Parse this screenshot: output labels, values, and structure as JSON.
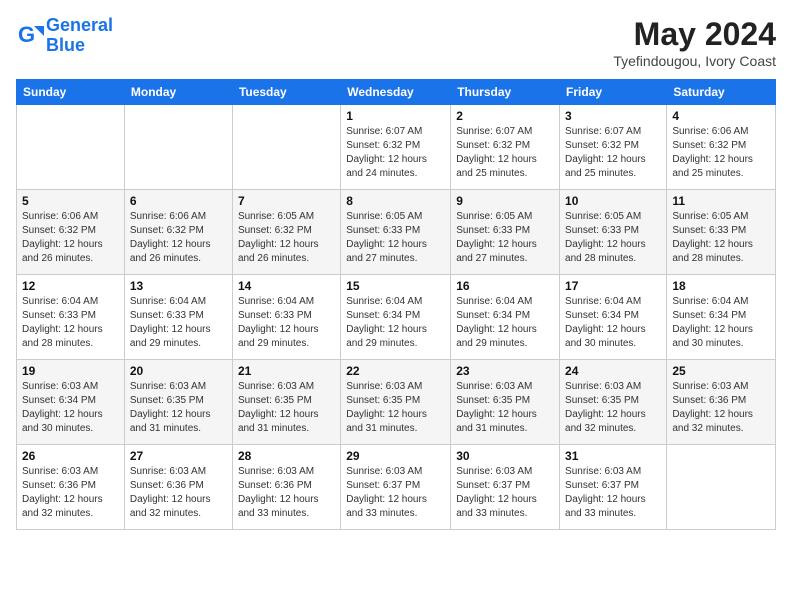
{
  "header": {
    "logo_line1": "General",
    "logo_line2": "Blue",
    "month_year": "May 2024",
    "location": "Tyefindougou, Ivory Coast"
  },
  "days_of_week": [
    "Sunday",
    "Monday",
    "Tuesday",
    "Wednesday",
    "Thursday",
    "Friday",
    "Saturday"
  ],
  "weeks": [
    [
      {
        "day": "",
        "info": ""
      },
      {
        "day": "",
        "info": ""
      },
      {
        "day": "",
        "info": ""
      },
      {
        "day": "1",
        "info": "Sunrise: 6:07 AM\nSunset: 6:32 PM\nDaylight: 12 hours\nand 24 minutes."
      },
      {
        "day": "2",
        "info": "Sunrise: 6:07 AM\nSunset: 6:32 PM\nDaylight: 12 hours\nand 25 minutes."
      },
      {
        "day": "3",
        "info": "Sunrise: 6:07 AM\nSunset: 6:32 PM\nDaylight: 12 hours\nand 25 minutes."
      },
      {
        "day": "4",
        "info": "Sunrise: 6:06 AM\nSunset: 6:32 PM\nDaylight: 12 hours\nand 25 minutes."
      }
    ],
    [
      {
        "day": "5",
        "info": "Sunrise: 6:06 AM\nSunset: 6:32 PM\nDaylight: 12 hours\nand 26 minutes."
      },
      {
        "day": "6",
        "info": "Sunrise: 6:06 AM\nSunset: 6:32 PM\nDaylight: 12 hours\nand 26 minutes."
      },
      {
        "day": "7",
        "info": "Sunrise: 6:05 AM\nSunset: 6:32 PM\nDaylight: 12 hours\nand 26 minutes."
      },
      {
        "day": "8",
        "info": "Sunrise: 6:05 AM\nSunset: 6:33 PM\nDaylight: 12 hours\nand 27 minutes."
      },
      {
        "day": "9",
        "info": "Sunrise: 6:05 AM\nSunset: 6:33 PM\nDaylight: 12 hours\nand 27 minutes."
      },
      {
        "day": "10",
        "info": "Sunrise: 6:05 AM\nSunset: 6:33 PM\nDaylight: 12 hours\nand 28 minutes."
      },
      {
        "day": "11",
        "info": "Sunrise: 6:05 AM\nSunset: 6:33 PM\nDaylight: 12 hours\nand 28 minutes."
      }
    ],
    [
      {
        "day": "12",
        "info": "Sunrise: 6:04 AM\nSunset: 6:33 PM\nDaylight: 12 hours\nand 28 minutes."
      },
      {
        "day": "13",
        "info": "Sunrise: 6:04 AM\nSunset: 6:33 PM\nDaylight: 12 hours\nand 29 minutes."
      },
      {
        "day": "14",
        "info": "Sunrise: 6:04 AM\nSunset: 6:33 PM\nDaylight: 12 hours\nand 29 minutes."
      },
      {
        "day": "15",
        "info": "Sunrise: 6:04 AM\nSunset: 6:34 PM\nDaylight: 12 hours\nand 29 minutes."
      },
      {
        "day": "16",
        "info": "Sunrise: 6:04 AM\nSunset: 6:34 PM\nDaylight: 12 hours\nand 29 minutes."
      },
      {
        "day": "17",
        "info": "Sunrise: 6:04 AM\nSunset: 6:34 PM\nDaylight: 12 hours\nand 30 minutes."
      },
      {
        "day": "18",
        "info": "Sunrise: 6:04 AM\nSunset: 6:34 PM\nDaylight: 12 hours\nand 30 minutes."
      }
    ],
    [
      {
        "day": "19",
        "info": "Sunrise: 6:03 AM\nSunset: 6:34 PM\nDaylight: 12 hours\nand 30 minutes."
      },
      {
        "day": "20",
        "info": "Sunrise: 6:03 AM\nSunset: 6:35 PM\nDaylight: 12 hours\nand 31 minutes."
      },
      {
        "day": "21",
        "info": "Sunrise: 6:03 AM\nSunset: 6:35 PM\nDaylight: 12 hours\nand 31 minutes."
      },
      {
        "day": "22",
        "info": "Sunrise: 6:03 AM\nSunset: 6:35 PM\nDaylight: 12 hours\nand 31 minutes."
      },
      {
        "day": "23",
        "info": "Sunrise: 6:03 AM\nSunset: 6:35 PM\nDaylight: 12 hours\nand 31 minutes."
      },
      {
        "day": "24",
        "info": "Sunrise: 6:03 AM\nSunset: 6:35 PM\nDaylight: 12 hours\nand 32 minutes."
      },
      {
        "day": "25",
        "info": "Sunrise: 6:03 AM\nSunset: 6:36 PM\nDaylight: 12 hours\nand 32 minutes."
      }
    ],
    [
      {
        "day": "26",
        "info": "Sunrise: 6:03 AM\nSunset: 6:36 PM\nDaylight: 12 hours\nand 32 minutes."
      },
      {
        "day": "27",
        "info": "Sunrise: 6:03 AM\nSunset: 6:36 PM\nDaylight: 12 hours\nand 32 minutes."
      },
      {
        "day": "28",
        "info": "Sunrise: 6:03 AM\nSunset: 6:36 PM\nDaylight: 12 hours\nand 33 minutes."
      },
      {
        "day": "29",
        "info": "Sunrise: 6:03 AM\nSunset: 6:37 PM\nDaylight: 12 hours\nand 33 minutes."
      },
      {
        "day": "30",
        "info": "Sunrise: 6:03 AM\nSunset: 6:37 PM\nDaylight: 12 hours\nand 33 minutes."
      },
      {
        "day": "31",
        "info": "Sunrise: 6:03 AM\nSunset: 6:37 PM\nDaylight: 12 hours\nand 33 minutes."
      },
      {
        "day": "",
        "info": ""
      }
    ]
  ]
}
